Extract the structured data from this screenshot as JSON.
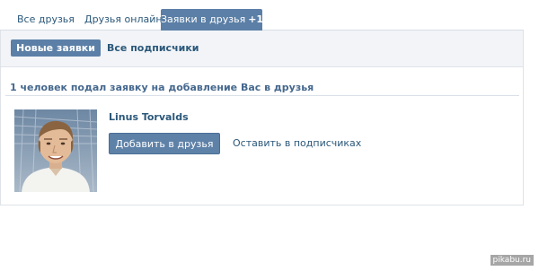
{
  "tabs": [
    {
      "label": "Все друзья"
    },
    {
      "label": "Друзья онлайн"
    },
    {
      "label": "Заявки в друзья",
      "count": "+1"
    }
  ],
  "filters": {
    "active": "Новые заявки",
    "other": "Все подписчики"
  },
  "requests": {
    "summary": "1 человек подал заявку на добавление Вас в друзья",
    "items": [
      {
        "name": "Linus Torvalds",
        "add_label": "Добавить в друзья",
        "keep_label": "Оставить в подписчиках"
      }
    ]
  },
  "watermark": "pikabu.ru",
  "colors": {
    "accent": "#5b7fa6",
    "link": "#2b587a",
    "subbar_bg": "#f2f4f7"
  }
}
